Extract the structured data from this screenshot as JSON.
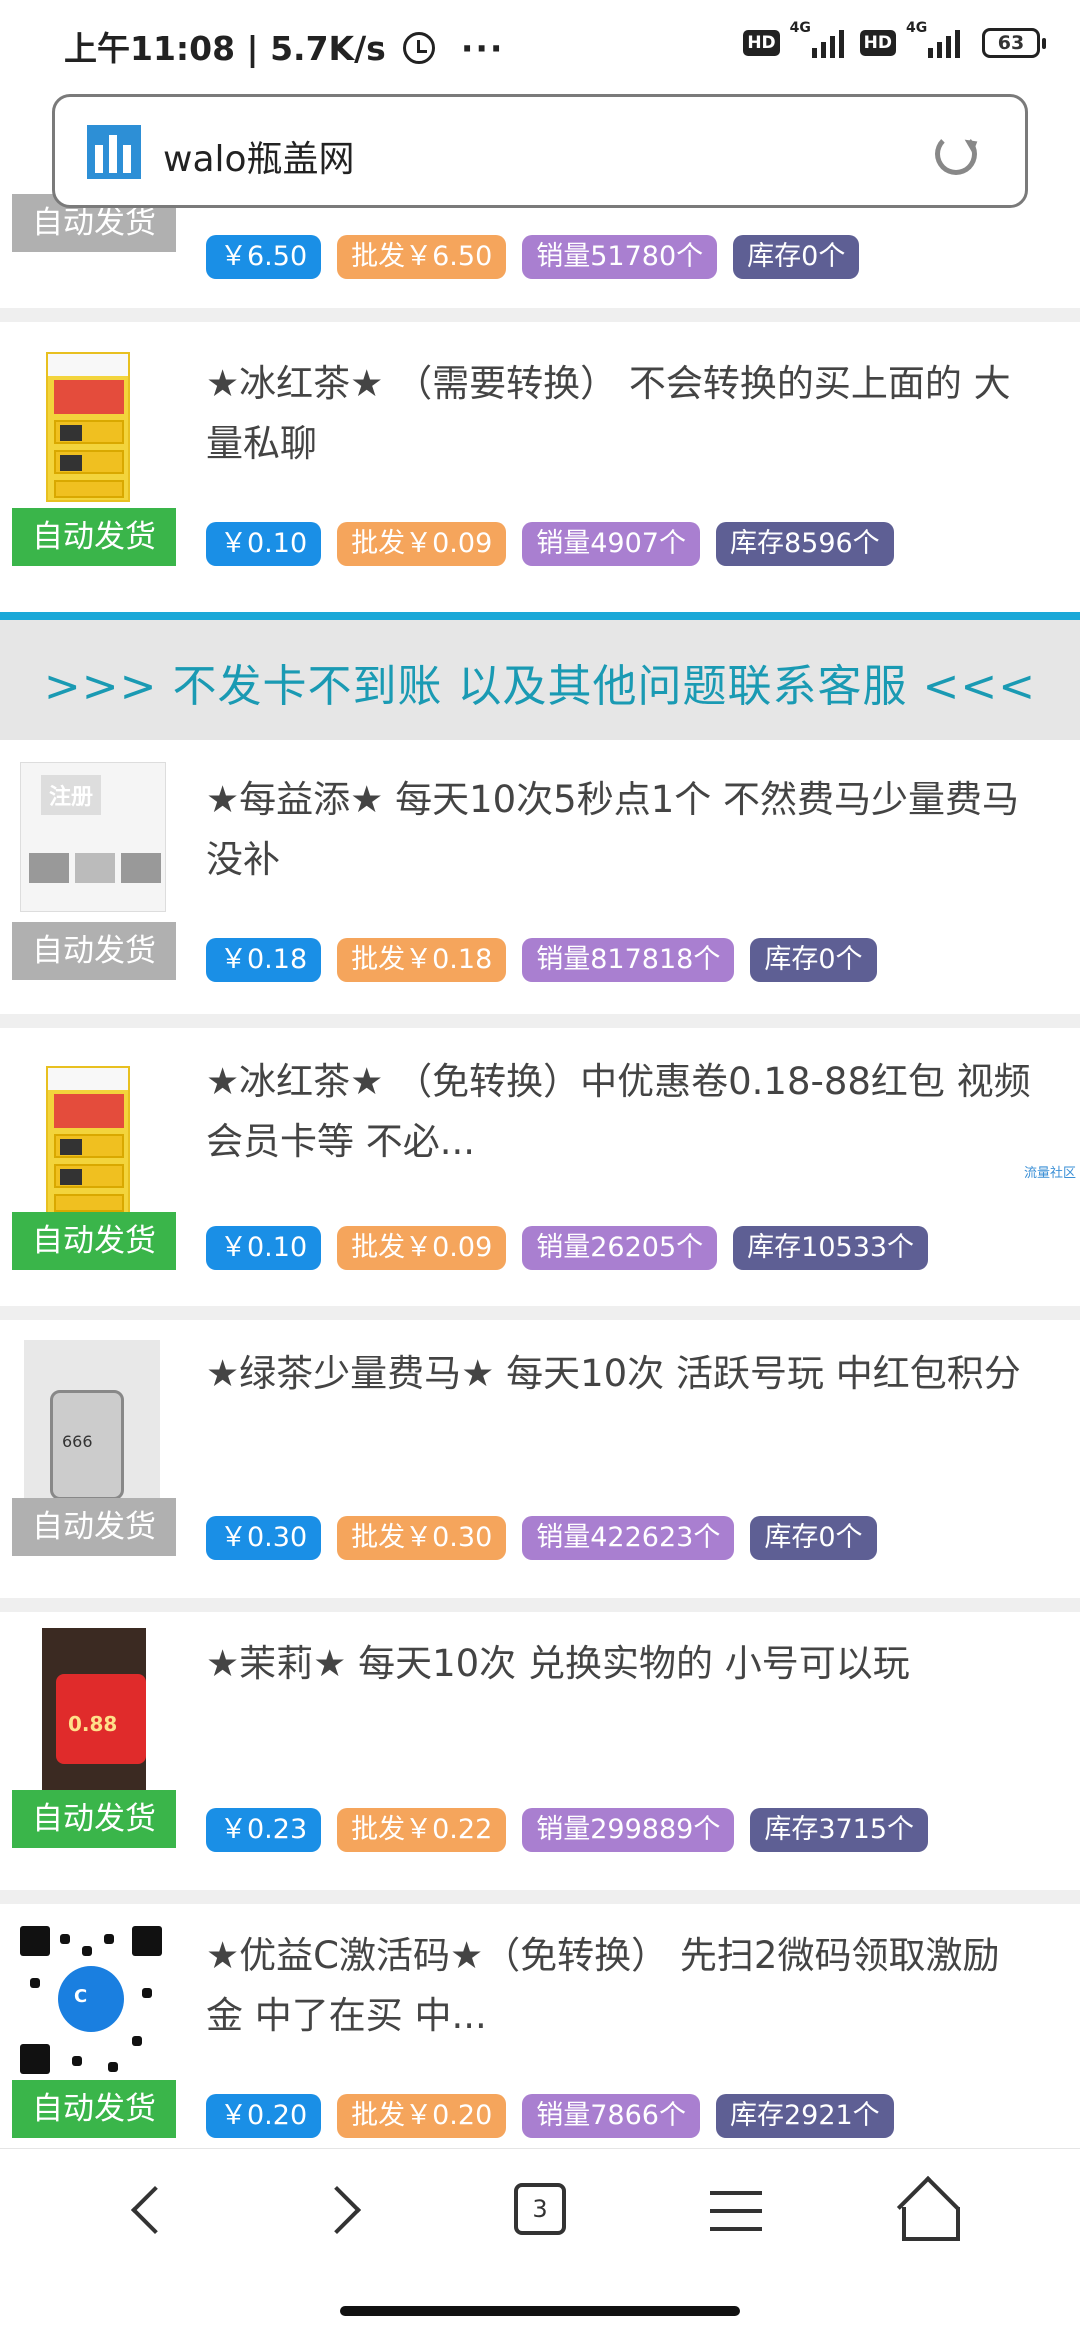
{
  "status_bar": {
    "time_speed": "上午11:08 | 5.7K/s",
    "more": "···",
    "hd1": "HD",
    "network1": "4G",
    "hd2": "HD",
    "network2": "4G",
    "battery": "63"
  },
  "address_bar": {
    "title": "walo瓶盖网"
  },
  "top_partial_item": {
    "badge": "自动发货",
    "price": "￥6.50",
    "wholesale": "批发￥6.50",
    "sales": "销量51780个",
    "stock": "库存0个"
  },
  "banner": {
    "text": ">>> 不发卡不到账 以及其他问题联系客服 <<<"
  },
  "items": [
    {
      "title": "★冰红茶★ （需要转换） 不会转换的买上面的 大量私聊",
      "badge": "自动发货",
      "price": "￥0.10",
      "wholesale": "批发￥0.09",
      "sales": "销量4907个",
      "stock": "库存8596个"
    },
    {
      "title": "★每益添★ 每天10次5秒点1个 不然费马少量费马没补",
      "badge": "自动发货",
      "thumb_label": "注册",
      "price": "￥0.18",
      "wholesale": "批发￥0.18",
      "sales": "销量817818个",
      "stock": "库存0个"
    },
    {
      "title": "★冰红茶★ （免转换）中优惠卷0.18-88红包 视频会员卡等 不必...",
      "badge": "自动发货",
      "price": "￥0.10",
      "wholesale": "批发￥0.09",
      "sales": "销量26205个",
      "stock": "库存10533个"
    },
    {
      "title": "★绿茶少量费马★ 每天10次 活跃号玩 中红包积分",
      "badge": "自动发货",
      "thumb_label": "666",
      "price": "￥0.30",
      "wholesale": "批发￥0.30",
      "sales": "销量422623个",
      "stock": "库存0个"
    },
    {
      "title": "★茉莉★ 每天10次 兑换实物的 小号可以玩",
      "badge": "自动发货",
      "thumb_label": "0.88",
      "price": "￥0.23",
      "wholesale": "批发￥0.22",
      "sales": "销量299889个",
      "stock": "库存3715个"
    },
    {
      "title": "★优益C激活码★（免转换） 先扫2微码领取激励金 中了在买 中...",
      "badge": "自动发货",
      "thumb_label": "C",
      "price": "￥0.20",
      "wholesale": "批发￥0.20",
      "sales": "销量7866个",
      "stock": "库存2921个"
    }
  ],
  "side_watermark": "流量社区",
  "bottom_nav": {
    "tab_count": "3"
  }
}
